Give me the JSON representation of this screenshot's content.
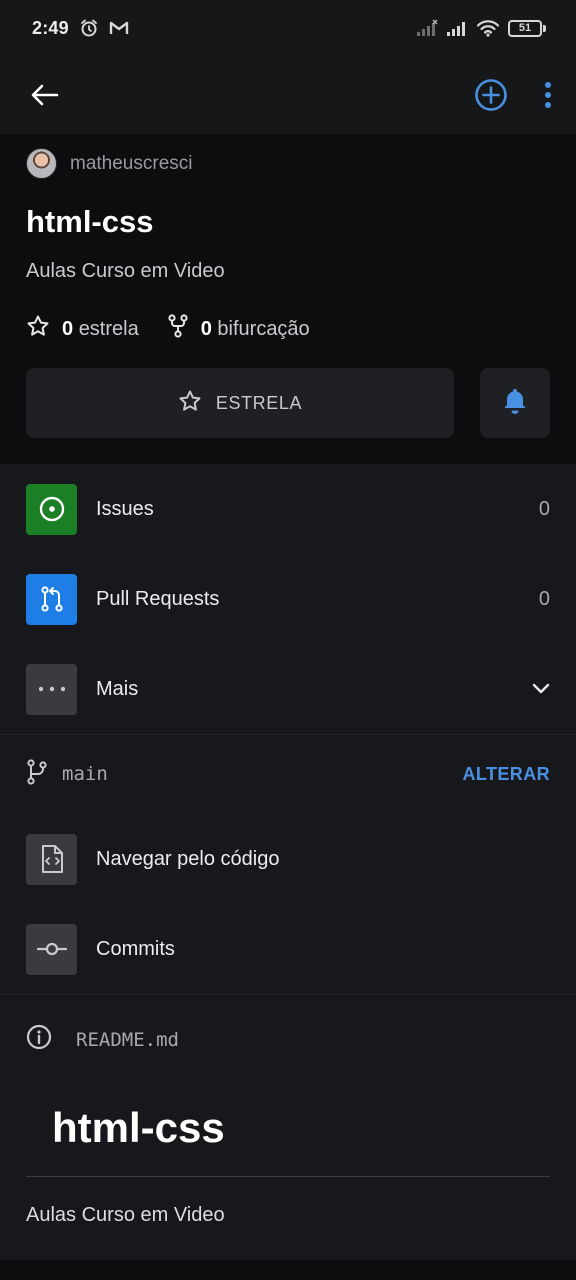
{
  "status_bar": {
    "time": "2:49",
    "battery": "51",
    "icons": [
      "alarm-icon",
      "gmail-icon",
      "signal-icon",
      "signal-icon",
      "wifi-icon",
      "battery-icon"
    ]
  },
  "app_bar": {
    "icons": [
      "back-arrow-icon",
      "add-circle-icon",
      "more-vertical-icon"
    ],
    "accent": "#4a90e2"
  },
  "repo": {
    "owner": "matheuscresci",
    "name": "html-css",
    "description": "Aulas Curso em Video",
    "stars_count": "0",
    "stars_label": "estrela",
    "forks_count": "0",
    "forks_label": "bifurcação",
    "star_button_label": "ESTRELA"
  },
  "menu": {
    "items": [
      {
        "label": "Issues",
        "count": "0",
        "icon": "issue-opened-icon",
        "color": "#1b7f25"
      },
      {
        "label": "Pull Requests",
        "count": "0",
        "icon": "pull-request-icon",
        "color": "#1e7ee6"
      },
      {
        "label": "Mais",
        "icon": "more-horizontal-icon",
        "color": "#3a3b40"
      }
    ]
  },
  "branch": {
    "name": "main",
    "change_label": "ALTERAR"
  },
  "code_items": [
    {
      "label": "Navegar pelo código",
      "icon": "file-code-icon"
    },
    {
      "label": "Commits",
      "icon": "commit-icon"
    }
  ],
  "readme": {
    "filename": "README.md",
    "title": "html-css",
    "text": "Aulas Curso em Video"
  }
}
